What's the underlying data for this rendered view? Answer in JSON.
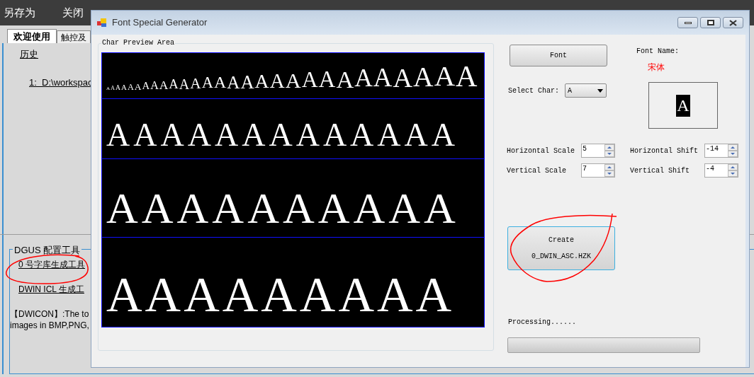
{
  "app_menu": [
    "另存为",
    "关闭"
  ],
  "app_tabs": [
    {
      "label": "欢迎使用",
      "selected": true
    },
    {
      "label": "触控及",
      "selected": false
    }
  ],
  "history": {
    "title": "历史",
    "items": [
      "1:  D:\\workspac"
    ]
  },
  "tools_group": {
    "title": "DGUS 配置工具",
    "links": [
      "0 号字库生成工具",
      "DWIN ICL 生成工"
    ],
    "description": [
      "【DWICON】:The to",
      "images in BMP,PNG,"
    ]
  },
  "window": {
    "title": "Font Special Generator"
  },
  "preview": {
    "title": "Char Preview Area",
    "rows": [
      {
        "glyphs": [
          "A",
          "A",
          "A",
          "A",
          "A",
          "A",
          "A",
          "A",
          "A",
          "A",
          "A",
          "A",
          "A",
          "A",
          "A",
          "A",
          "A",
          "A",
          "A",
          "A",
          "A",
          "A",
          "A",
          "A",
          "A",
          "A",
          "A",
          "A"
        ]
      },
      {
        "glyphs": [
          "A",
          "A",
          "A",
          "A",
          "A",
          "A",
          "A",
          "A",
          "A",
          "A",
          "A",
          "A",
          "A"
        ]
      },
      {
        "glyphs": [
          "A",
          "A",
          "A",
          "A",
          "A",
          "A",
          "A",
          "A",
          "A",
          "A"
        ]
      },
      {
        "glyphs": [
          "A",
          "A",
          "A",
          "A",
          "A",
          "A",
          "A",
          "A",
          "A"
        ]
      }
    ]
  },
  "font_button": "Font",
  "font_name": {
    "label": "Font Name:",
    "value": "宋体"
  },
  "select_char": {
    "label": "Select Char:",
    "value": "A"
  },
  "char_sample": "A",
  "spinners": [
    {
      "label": "Horizontal Scale",
      "value": "5"
    },
    {
      "label": "Horizontal Shift",
      "value": "-14"
    },
    {
      "label": "Vertical Scale",
      "value": "7"
    },
    {
      "label": "Vertical Shift",
      "value": "-4"
    }
  ],
  "create_button": [
    "Create",
    "0_DWIN_ASC.HZK"
  ],
  "status": "Processing......",
  "progress": {
    "level": 0
  }
}
